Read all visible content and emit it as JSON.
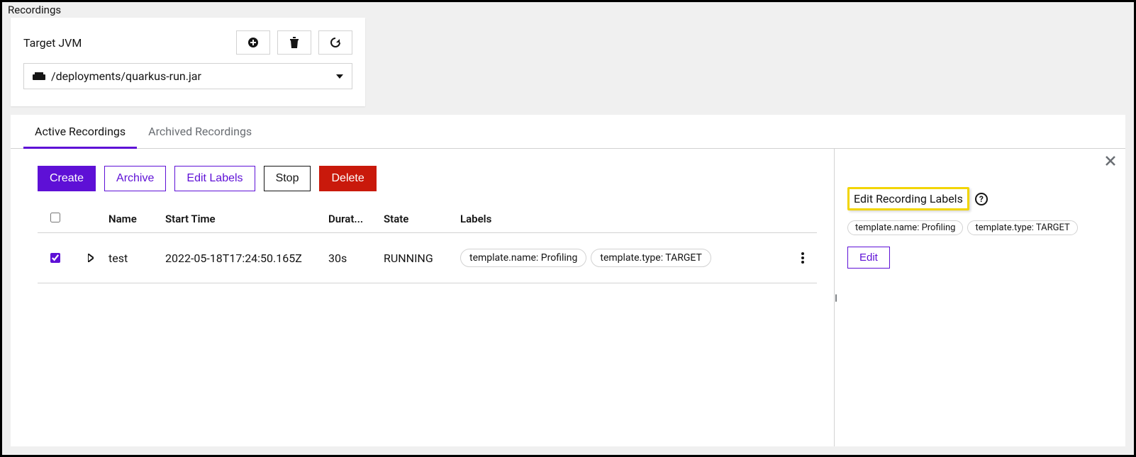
{
  "header": {
    "title": "Recordings"
  },
  "target": {
    "label": "Target JVM",
    "selected": "/deployments/quarkus-run.jar"
  },
  "tabs": [
    {
      "label": "Active Recordings",
      "active": true
    },
    {
      "label": "Archived Recordings",
      "active": false
    }
  ],
  "toolbar": {
    "create": "Create",
    "archive": "Archive",
    "edit_labels": "Edit Labels",
    "stop": "Stop",
    "delete": "Delete"
  },
  "table": {
    "headers": {
      "name": "Name",
      "start": "Start Time",
      "duration": "Durat...",
      "state": "State",
      "labels": "Labels"
    },
    "rows": [
      {
        "checked": true,
        "name": "test",
        "start": "2022-05-18T17:24:50.165Z",
        "duration": "30s",
        "state": "RUNNING",
        "labels": [
          "template.name: Profiling",
          "template.type: TARGET"
        ]
      }
    ]
  },
  "side_panel": {
    "title": "Edit Recording Labels",
    "chips": [
      "template.name: Profiling",
      "template.type: TARGET"
    ],
    "edit_button": "Edit"
  }
}
